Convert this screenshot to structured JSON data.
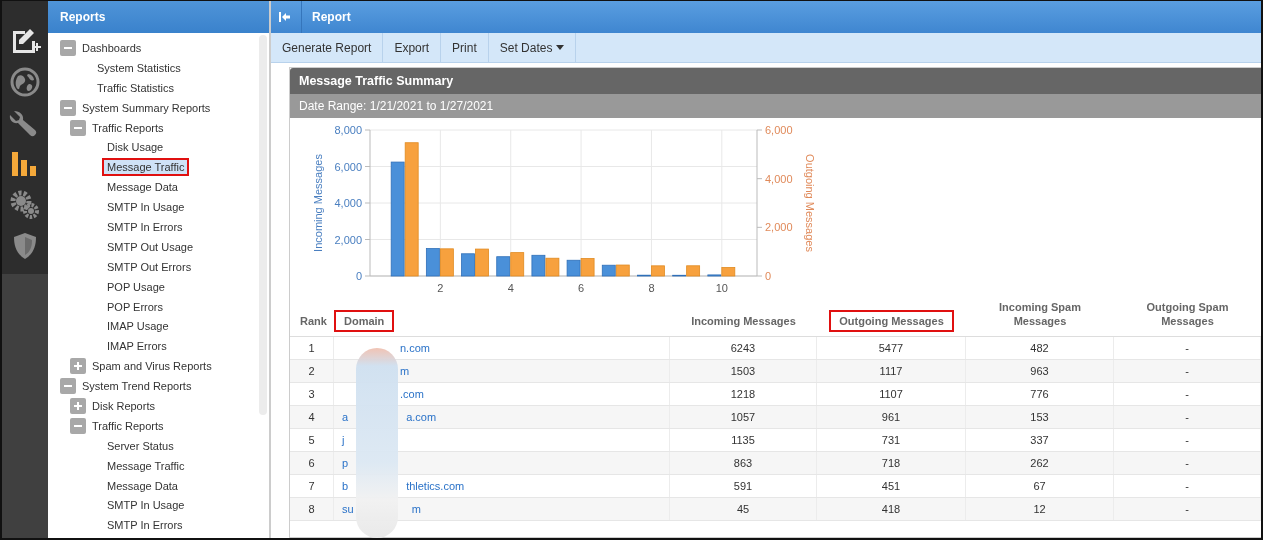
{
  "rail": {
    "items": [
      {
        "kind": "compose",
        "selected": false
      },
      {
        "kind": "globe",
        "selected": false
      },
      {
        "kind": "wrench",
        "selected": false
      },
      {
        "kind": "chart",
        "selected": true
      },
      {
        "kind": "gears",
        "selected": false
      },
      {
        "kind": "shield",
        "selected": false
      }
    ]
  },
  "sidebar": {
    "title": "Reports",
    "tree": [
      {
        "label": "Dashboards",
        "expanded": true,
        "children": [
          {
            "label": "System Statistics",
            "selected": false,
            "highlighted": false
          },
          {
            "label": "Traffic Statistics",
            "selected": false,
            "highlighted": false
          }
        ]
      },
      {
        "label": "System Summary Reports",
        "expanded": true,
        "children": [
          {
            "label": "Traffic Reports",
            "expanded": true,
            "children": [
              {
                "label": "Disk Usage",
                "selected": false,
                "highlighted": false
              },
              {
                "label": "Message Traffic",
                "selected": true,
                "highlighted": true
              },
              {
                "label": "Message Data",
                "selected": false,
                "highlighted": false
              },
              {
                "label": "SMTP In Usage",
                "selected": false,
                "highlighted": false
              },
              {
                "label": "SMTP In Errors",
                "selected": false,
                "highlighted": false
              },
              {
                "label": "SMTP Out Usage",
                "selected": false,
                "highlighted": false
              },
              {
                "label": "SMTP Out Errors",
                "selected": false,
                "highlighted": false
              },
              {
                "label": "POP Usage",
                "selected": false,
                "highlighted": false
              },
              {
                "label": "POP Errors",
                "selected": false,
                "highlighted": false
              },
              {
                "label": "IMAP Usage",
                "selected": false,
                "highlighted": false
              },
              {
                "label": "IMAP Errors",
                "selected": false,
                "highlighted": false
              }
            ]
          },
          {
            "label": "Spam and Virus Reports",
            "expanded": false
          }
        ]
      },
      {
        "label": "System Trend Reports",
        "expanded": true,
        "children": [
          {
            "label": "Disk Reports",
            "expanded": false
          },
          {
            "label": "Traffic Reports",
            "expanded": true,
            "children": [
              {
                "label": "Server Status",
                "selected": false,
                "highlighted": false
              },
              {
                "label": "Message Traffic",
                "selected": false,
                "highlighted": false
              },
              {
                "label": "Message Data",
                "selected": false,
                "highlighted": false
              },
              {
                "label": "SMTP In Usage",
                "selected": false,
                "highlighted": false
              },
              {
                "label": "SMTP In Errors",
                "selected": false,
                "highlighted": false
              }
            ]
          }
        ]
      }
    ]
  },
  "main": {
    "title": "Report",
    "toolbar": [
      {
        "label": "Generate Report",
        "dropdown": false
      },
      {
        "label": "Export",
        "dropdown": false
      },
      {
        "label": "Print",
        "dropdown": false
      },
      {
        "label": "Set Dates",
        "dropdown": true
      }
    ]
  },
  "card": {
    "title": "Message Traffic Summary",
    "subtitle": "Date Range: 1/21/2021 to 1/27/2021",
    "chart_data": {
      "type": "bar",
      "stacked": false,
      "grid": true,
      "x": [
        1,
        2,
        3,
        4,
        5,
        6,
        7,
        8,
        9,
        10
      ],
      "xlim": [
        0,
        11
      ],
      "xticks": [
        2,
        4,
        6,
        8,
        10
      ],
      "ylim": [
        0,
        8000
      ],
      "yticks": [
        {
          "value": 0,
          "label": "0"
        },
        {
          "value": 2000,
          "label": "2,000"
        },
        {
          "value": 4000,
          "label": "4,000"
        },
        {
          "value": 6000,
          "label": "6,000"
        },
        {
          "value": 8000,
          "label": "8,000"
        }
      ],
      "y2lim": [
        0,
        6000
      ],
      "y2ticks": [
        {
          "value": 0,
          "label": "0"
        },
        {
          "value": 2000,
          "label": "2,000"
        },
        {
          "value": 4000,
          "label": "4,000"
        },
        {
          "value": 6000,
          "label": "6,000"
        }
      ],
      "series": [
        {
          "name": "Incoming Messages",
          "color": "#4a90d9",
          "values": [
            6243,
            1503,
            1218,
            1057,
            1135,
            863,
            591,
            45,
            40,
            60
          ]
        },
        {
          "name": "Outgoing Messages",
          "color": "#f7a13e",
          "axis": "y2",
          "values": [
            5477,
            1117,
            1107,
            961,
            731,
            718,
            451,
            418,
            420,
            350
          ]
        }
      ]
    },
    "table": {
      "columns": [
        {
          "label": "Rank",
          "highlighted": false
        },
        {
          "label": "Domain",
          "highlighted": true
        },
        {
          "label": "Incoming Messages",
          "highlighted": false
        },
        {
          "label": "Outgoing Messages",
          "highlighted": true
        },
        {
          "label": "Incoming Spam Messages",
          "highlighted": false
        },
        {
          "label": "Outgoing Spam Messages",
          "highlighted": false
        }
      ],
      "rows": [
        {
          "rank": "1",
          "domain_start": "",
          "domain_end": "n.com",
          "incoming": "6243",
          "outgoing": "5477",
          "incoming_spam": "482",
          "outgoing_spam": "-"
        },
        {
          "rank": "2",
          "domain_start": "",
          "domain_end": "m",
          "incoming": "1503",
          "outgoing": "1117",
          "incoming_spam": "963",
          "outgoing_spam": "-"
        },
        {
          "rank": "3",
          "domain_start": "",
          "domain_end": ".com",
          "incoming": "1218",
          "outgoing": "1107",
          "incoming_spam": "776",
          "outgoing_spam": "-"
        },
        {
          "rank": "4",
          "domain_start": "a",
          "domain_end": "a.com",
          "incoming": "1057",
          "outgoing": "961",
          "incoming_spam": "153",
          "outgoing_spam": "-"
        },
        {
          "rank": "5",
          "domain_start": "j",
          "domain_end": "",
          "incoming": "1135",
          "outgoing": "731",
          "incoming_spam": "337",
          "outgoing_spam": "-"
        },
        {
          "rank": "6",
          "domain_start": "p",
          "domain_end": "",
          "incoming": "863",
          "outgoing": "718",
          "incoming_spam": "262",
          "outgoing_spam": "-"
        },
        {
          "rank": "7",
          "domain_start": "b",
          "domain_end": "thletics.com",
          "incoming": "591",
          "outgoing": "451",
          "incoming_spam": "67",
          "outgoing_spam": "-"
        },
        {
          "rank": "8",
          "domain_start": "su",
          "domain_end": "m",
          "incoming": "45",
          "outgoing": "418",
          "incoming_spam": "12",
          "outgoing_spam": "-"
        }
      ]
    }
  }
}
